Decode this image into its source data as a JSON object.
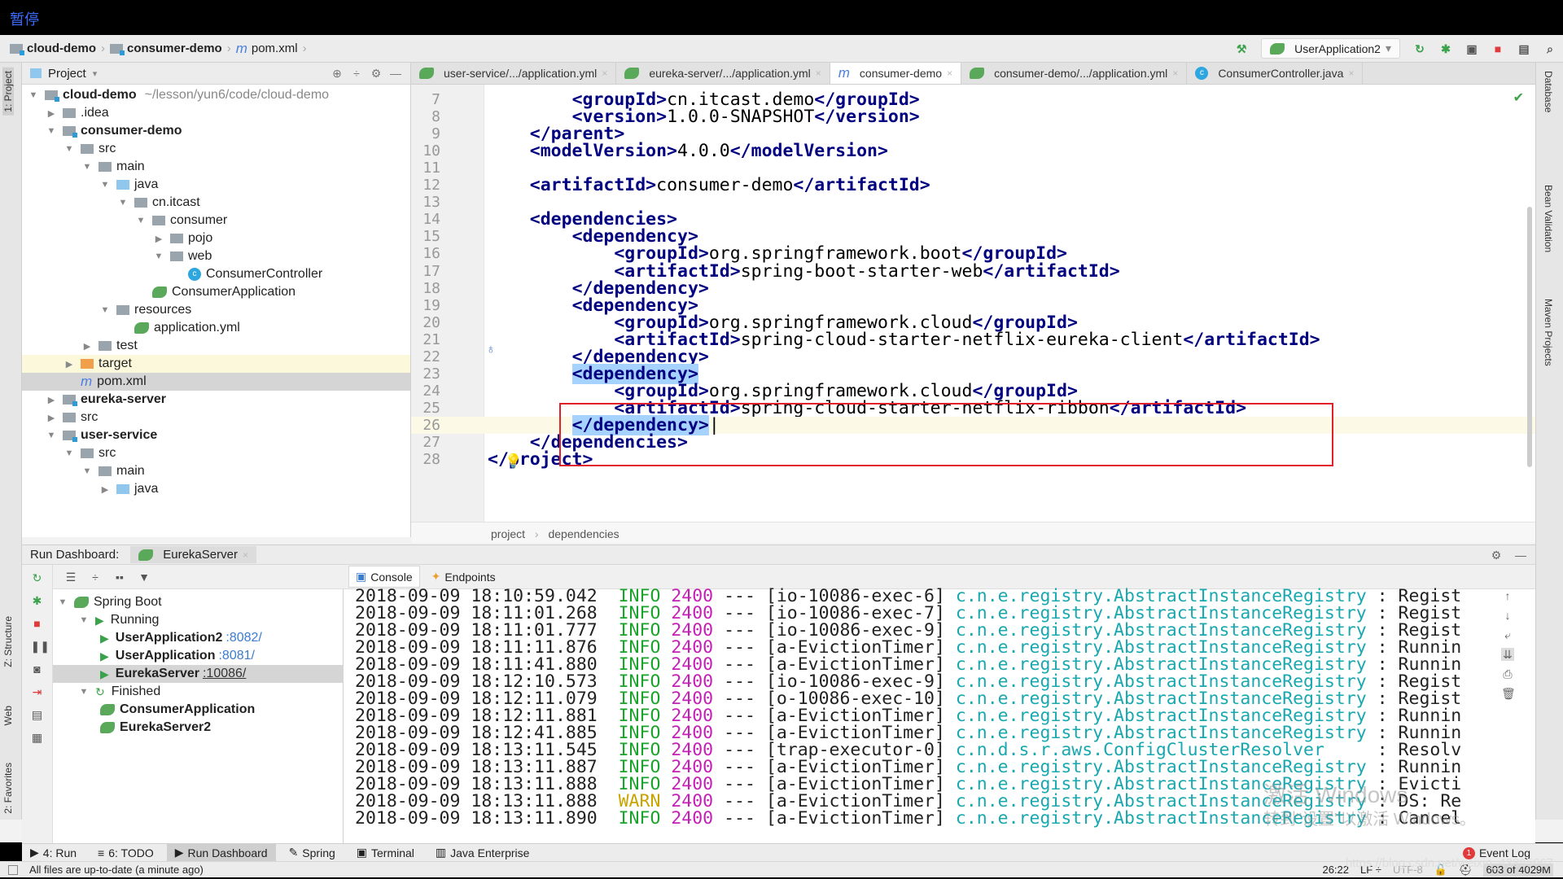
{
  "overlay": {
    "pause_label": "暂停"
  },
  "breadcrumb": [
    "cloud-demo",
    "consumer-demo",
    "pom.xml"
  ],
  "toolbar": {
    "run_config": "UserApplication2"
  },
  "left_stripe": [
    "1: Project",
    "Z: Structure",
    "Web",
    "2: Favorites"
  ],
  "right_stripe": [
    "Database",
    "Bean Validation",
    "Maven Projects"
  ],
  "project": {
    "title": "Project",
    "root_path": "~/lesson/yun6/code/cloud-demo",
    "items": [
      {
        "label": "cloud-demo",
        "depth": 0,
        "arrow": "down",
        "icon": "module",
        "bold": true
      },
      {
        "label": ".idea",
        "depth": 1,
        "arrow": "right",
        "icon": "folder"
      },
      {
        "label": "consumer-demo",
        "depth": 1,
        "arrow": "down",
        "icon": "module",
        "bold": true
      },
      {
        "label": "src",
        "depth": 2,
        "arrow": "down",
        "icon": "folder"
      },
      {
        "label": "main",
        "depth": 3,
        "arrow": "down",
        "icon": "folder"
      },
      {
        "label": "java",
        "depth": 4,
        "arrow": "down",
        "icon": "blue-folder"
      },
      {
        "label": "cn.itcast",
        "depth": 5,
        "arrow": "down",
        "icon": "package"
      },
      {
        "label": "consumer",
        "depth": 6,
        "arrow": "down",
        "icon": "package"
      },
      {
        "label": "pojo",
        "depth": 7,
        "arrow": "right",
        "icon": "package"
      },
      {
        "label": "web",
        "depth": 7,
        "arrow": "down",
        "icon": "package"
      },
      {
        "label": "ConsumerController",
        "depth": 8,
        "arrow": "",
        "icon": "class"
      },
      {
        "label": "ConsumerApplication",
        "depth": 6,
        "arrow": "",
        "icon": "spring"
      },
      {
        "label": "resources",
        "depth": 4,
        "arrow": "down",
        "icon": "folder"
      },
      {
        "label": "application.yml",
        "depth": 5,
        "arrow": "",
        "icon": "spring"
      },
      {
        "label": "test",
        "depth": 3,
        "arrow": "right",
        "icon": "folder"
      },
      {
        "label": "target",
        "depth": 2,
        "arrow": "right",
        "icon": "orange-folder",
        "state": "hl"
      },
      {
        "label": "pom.xml",
        "depth": 2,
        "arrow": "",
        "icon": "maven",
        "state": "sel"
      },
      {
        "label": "eureka-server",
        "depth": 1,
        "arrow": "right",
        "icon": "module",
        "bold": true
      },
      {
        "label": "src",
        "depth": 1,
        "arrow": "right",
        "icon": "folder"
      },
      {
        "label": "user-service",
        "depth": 1,
        "arrow": "down",
        "icon": "module",
        "bold": true
      },
      {
        "label": "src",
        "depth": 2,
        "arrow": "down",
        "icon": "folder"
      },
      {
        "label": "main",
        "depth": 3,
        "arrow": "down",
        "icon": "folder"
      },
      {
        "label": "java",
        "depth": 4,
        "arrow": "right",
        "icon": "blue-folder"
      }
    ]
  },
  "tabs": [
    {
      "label": "user-service/.../application.yml",
      "icon": "spring"
    },
    {
      "label": "eureka-server/.../application.yml",
      "icon": "spring"
    },
    {
      "label": "consumer-demo",
      "icon": "maven",
      "active": true
    },
    {
      "label": "consumer-demo/.../application.yml",
      "icon": "spring"
    },
    {
      "label": "ConsumerController.java",
      "icon": "class"
    }
  ],
  "editor": {
    "cursor": "26:22",
    "lines": [
      {
        "n": "7",
        "indent": 8,
        "parts": [
          [
            "t",
            "<groupId>"
          ],
          [
            "x",
            "cn.itcast.demo"
          ],
          [
            "t",
            "</groupId>"
          ]
        ]
      },
      {
        "n": "8",
        "indent": 8,
        "parts": [
          [
            "t",
            "<version>"
          ],
          [
            "x",
            "1.0.0-SNAPSHOT"
          ],
          [
            "t",
            "</version>"
          ]
        ]
      },
      {
        "n": "9",
        "indent": 4,
        "parts": [
          [
            "t",
            "</parent>"
          ]
        ]
      },
      {
        "n": "10",
        "indent": 4,
        "parts": [
          [
            "t",
            "<modelVersion>"
          ],
          [
            "x",
            "4.0.0"
          ],
          [
            "t",
            "</modelVersion>"
          ]
        ]
      },
      {
        "n": "11",
        "indent": 0,
        "parts": []
      },
      {
        "n": "12",
        "indent": 4,
        "parts": [
          [
            "t",
            "<artifactId>"
          ],
          [
            "x",
            "consumer-demo"
          ],
          [
            "t",
            "</artifactId>"
          ]
        ]
      },
      {
        "n": "13",
        "indent": 0,
        "parts": []
      },
      {
        "n": "14",
        "indent": 4,
        "parts": [
          [
            "t",
            "<dependencies>"
          ]
        ]
      },
      {
        "n": "15",
        "indent": 8,
        "parts": [
          [
            "t",
            "<dependency>"
          ]
        ]
      },
      {
        "n": "16",
        "indent": 12,
        "parts": [
          [
            "t",
            "<groupId>"
          ],
          [
            "x",
            "org.springframework.boot"
          ],
          [
            "t",
            "</groupId>"
          ]
        ]
      },
      {
        "n": "17",
        "indent": 12,
        "parts": [
          [
            "t",
            "<artifactId>"
          ],
          [
            "x",
            "spring-boot-starter-web"
          ],
          [
            "t",
            "</artifactId>"
          ]
        ]
      },
      {
        "n": "18",
        "indent": 8,
        "parts": [
          [
            "t",
            "</dependency>"
          ]
        ]
      },
      {
        "n": "19",
        "indent": 8,
        "parts": [
          [
            "t",
            "<dependency>"
          ]
        ]
      },
      {
        "n": "20",
        "indent": 12,
        "parts": [
          [
            "t",
            "<groupId>"
          ],
          [
            "x",
            "org.springframework.cloud"
          ],
          [
            "t",
            "</groupId>"
          ]
        ]
      },
      {
        "n": "21",
        "indent": 12,
        "parts": [
          [
            "t",
            "<artifactId>"
          ],
          [
            "x",
            "spring-cloud-starter-netflix-eureka-client"
          ],
          [
            "t",
            "</artifactId>"
          ]
        ]
      },
      {
        "n": "22",
        "indent": 8,
        "parts": [
          [
            "t",
            "</dependency>"
          ]
        ]
      },
      {
        "n": "23",
        "indent": 8,
        "parts": [
          [
            "s",
            "<dependency>"
          ]
        ]
      },
      {
        "n": "24",
        "indent": 12,
        "parts": [
          [
            "t",
            "<groupId>"
          ],
          [
            "x",
            "org.springframework.cloud"
          ],
          [
            "t",
            "</groupId>"
          ]
        ]
      },
      {
        "n": "25",
        "indent": 12,
        "parts": [
          [
            "t",
            "<artifactId>"
          ],
          [
            "x",
            "spring-cloud-starter-netflix-ribbon"
          ],
          [
            "t",
            "</artifactId>"
          ]
        ]
      },
      {
        "n": "26",
        "indent": 8,
        "parts": [
          [
            "s",
            "</dependency>"
          ]
        ],
        "caret": true
      },
      {
        "n": "27",
        "indent": 4,
        "parts": [
          [
            "t",
            "</dependencies>"
          ]
        ]
      },
      {
        "n": "28",
        "indent": 0,
        "parts": [
          [
            "t",
            "</project>"
          ]
        ]
      }
    ],
    "breadcrumb": [
      "project",
      "dependencies"
    ]
  },
  "run_dashboard": {
    "title": "Run Dashboard:",
    "tab": "EurekaServer",
    "tree": [
      {
        "label": "Spring Boot",
        "depth": 0,
        "kind": "group"
      },
      {
        "label": "Running",
        "depth": 1,
        "kind": "group-run"
      },
      {
        "label": "UserApplication2",
        "port": ":8082/",
        "depth": 2,
        "kind": "run"
      },
      {
        "label": "UserApplication",
        "port": ":8081/",
        "depth": 2,
        "kind": "run"
      },
      {
        "label": "EurekaServer",
        "port": ":10086/",
        "depth": 2,
        "kind": "run",
        "selected": true
      },
      {
        "label": "Finished",
        "depth": 1,
        "kind": "group-fin"
      },
      {
        "label": "ConsumerApplication",
        "depth": 2,
        "kind": "fin"
      },
      {
        "label": "EurekaServer2",
        "depth": 2,
        "kind": "fin"
      }
    ],
    "console_tabs": [
      "Console",
      "Endpoints"
    ],
    "logs": [
      {
        "ts": "2018-09-09 18:10:59.042",
        "level": "INFO",
        "pid": "2400",
        "thread": "[io-10086-exec-6]",
        "logger": "c.n.e.registry.AbstractInstanceRegistry",
        "msg": ": Regist"
      },
      {
        "ts": "2018-09-09 18:11:01.268",
        "level": "INFO",
        "pid": "2400",
        "thread": "[io-10086-exec-7]",
        "logger": "c.n.e.registry.AbstractInstanceRegistry",
        "msg": ": Regist"
      },
      {
        "ts": "2018-09-09 18:11:01.777",
        "level": "INFO",
        "pid": "2400",
        "thread": "[io-10086-exec-9]",
        "logger": "c.n.e.registry.AbstractInstanceRegistry",
        "msg": ": Regist"
      },
      {
        "ts": "2018-09-09 18:11:11.876",
        "level": "INFO",
        "pid": "2400",
        "thread": "[a-EvictionTimer]",
        "logger": "c.n.e.registry.AbstractInstanceRegistry",
        "msg": ": Runnin"
      },
      {
        "ts": "2018-09-09 18:11:41.880",
        "level": "INFO",
        "pid": "2400",
        "thread": "[a-EvictionTimer]",
        "logger": "c.n.e.registry.AbstractInstanceRegistry",
        "msg": ": Runnin"
      },
      {
        "ts": "2018-09-09 18:12:10.573",
        "level": "INFO",
        "pid": "2400",
        "thread": "[io-10086-exec-9]",
        "logger": "c.n.e.registry.AbstractInstanceRegistry",
        "msg": ": Regist"
      },
      {
        "ts": "2018-09-09 18:12:11.079",
        "level": "INFO",
        "pid": "2400",
        "thread": "[o-10086-exec-10]",
        "logger": "c.n.e.registry.AbstractInstanceRegistry",
        "msg": ": Regist"
      },
      {
        "ts": "2018-09-09 18:12:11.881",
        "level": "INFO",
        "pid": "2400",
        "thread": "[a-EvictionTimer]",
        "logger": "c.n.e.registry.AbstractInstanceRegistry",
        "msg": ": Runnin"
      },
      {
        "ts": "2018-09-09 18:12:41.885",
        "level": "INFO",
        "pid": "2400",
        "thread": "[a-EvictionTimer]",
        "logger": "c.n.e.registry.AbstractInstanceRegistry",
        "msg": ": Runnin"
      },
      {
        "ts": "2018-09-09 18:13:11.545",
        "level": "INFO",
        "pid": "2400",
        "thread": "[trap-executor-0]",
        "logger": "c.n.d.s.r.aws.ConfigClusterResolver    ",
        "msg": ": Resolv"
      },
      {
        "ts": "2018-09-09 18:13:11.887",
        "level": "INFO",
        "pid": "2400",
        "thread": "[a-EvictionTimer]",
        "logger": "c.n.e.registry.AbstractInstanceRegistry",
        "msg": ": Runnin"
      },
      {
        "ts": "2018-09-09 18:13:11.888",
        "level": "INFO",
        "pid": "2400",
        "thread": "[a-EvictionTimer]",
        "logger": "c.n.e.registry.AbstractInstanceRegistry",
        "msg": ": Evicti"
      },
      {
        "ts": "2018-09-09 18:13:11.888",
        "level": "WARN",
        "pid": "2400",
        "thread": "[a-EvictionTimer]",
        "logger": "c.n.e.registry.AbstractInstanceRegistry",
        "msg": ": DS: Re"
      },
      {
        "ts": "2018-09-09 18:13:11.890",
        "level": "INFO",
        "pid": "2400",
        "thread": "[a-EvictionTimer]",
        "logger": "c.n.e.registry.AbstractInstanceRegistry",
        "msg": ": Cancel"
      }
    ],
    "watermark": [
      "激活 Windows",
      "转到\"设置\"以激活 Windows。"
    ]
  },
  "bottom_tabs": [
    {
      "label": "4: Run",
      "icon": "play"
    },
    {
      "label": "6: TODO",
      "icon": "list"
    },
    {
      "label": "Run Dashboard",
      "icon": "play",
      "active": true
    },
    {
      "label": "Spring",
      "icon": "spring"
    },
    {
      "label": "Terminal",
      "icon": "terminal"
    },
    {
      "label": "Java Enterprise",
      "icon": "je"
    }
  ],
  "event_log": {
    "label": "Event Log",
    "count": "1"
  },
  "status": {
    "message": "All files are up-to-date (a minute ago)",
    "position": "26:22",
    "line_sep": "LF ÷",
    "encoding": "UTF-8",
    "memory": "603 of 4029M"
  },
  "footer_url": "https://blog.csdn.net/weixin_43895667",
  "colors": {
    "tag": "#000080",
    "info": "#1aa32a",
    "warn": "#c8a400",
    "pid": "#c51fb8",
    "logger": "#1aa8b0",
    "highlight_box": "#e0202a"
  }
}
